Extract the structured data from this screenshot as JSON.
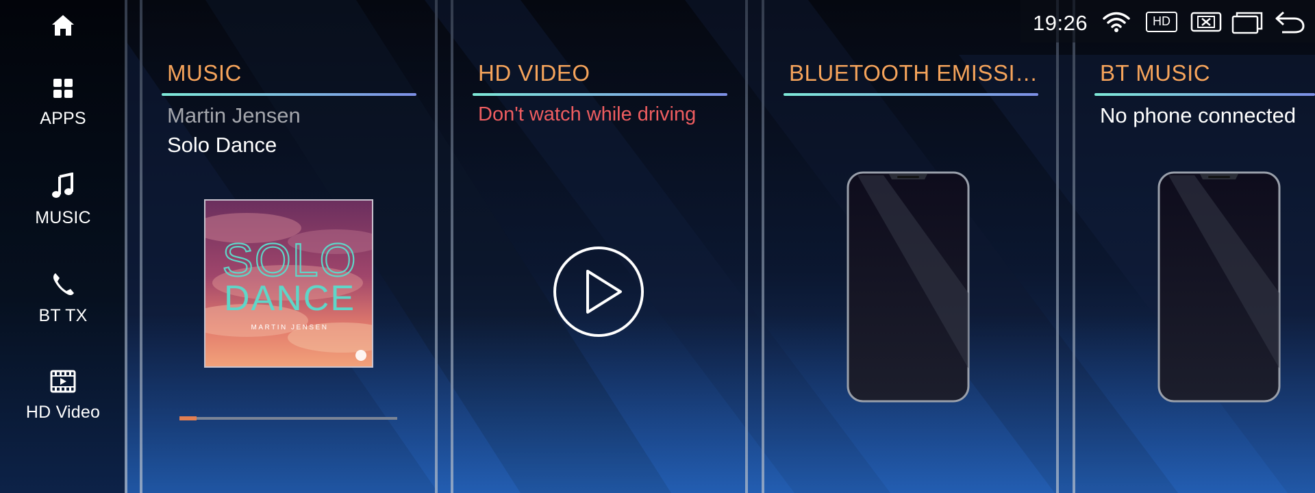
{
  "sidebar": {
    "items": [
      {
        "label": "",
        "icon": "home-icon"
      },
      {
        "label": "APPS",
        "icon": "apps-grid-icon"
      },
      {
        "label": "MUSIC",
        "icon": "music-note-icon"
      },
      {
        "label": "BT TX",
        "icon": "phone-handset-icon"
      },
      {
        "label": "HD Video",
        "icon": "film-play-icon"
      }
    ]
  },
  "statusbar": {
    "time": "19:26",
    "hd_badge": "HD",
    "icons": [
      "wifi-icon",
      "hd-icon",
      "close-box-icon",
      "window-icon",
      "back-icon"
    ]
  },
  "cards": {
    "music": {
      "title": "MUSIC",
      "artist": "Martin Jensen",
      "track": "Solo Dance",
      "progress_fraction": 0.08,
      "album_art": {
        "line1": "SOLO",
        "line2": "DANCE",
        "artist_caps": "MARTIN JENSEN"
      }
    },
    "video": {
      "title": "HD VIDEO",
      "warning": "Don't watch while driving"
    },
    "bluetooth": {
      "title": "BLUETOOTH EMISSI…"
    },
    "btmusic": {
      "title": "BT MUSIC",
      "status": "No phone connected"
    }
  },
  "colors": {
    "accent_title": "#f6a45b",
    "warning": "#ef5d60",
    "progress": "#e27f52",
    "rule_start": "#7ee9d8",
    "rule_end": "#7d8fe6"
  }
}
